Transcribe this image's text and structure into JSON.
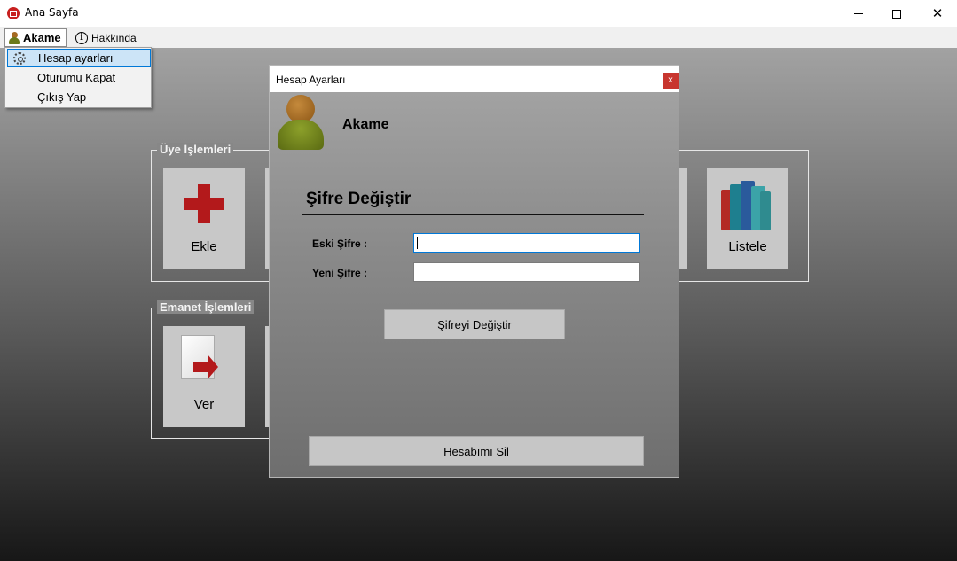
{
  "window": {
    "title": "Ana Sayfa"
  },
  "menubar": {
    "user_menu": "Akame",
    "about": "Hakkında"
  },
  "user_dropdown": [
    {
      "label": "Hesap ayarları",
      "icon": "gear-icon",
      "active": true
    },
    {
      "label": "Oturumu Kapat"
    },
    {
      "label": "Çıkış Yap"
    }
  ],
  "member_group": {
    "title": "Üye İşlemleri",
    "tiles": [
      {
        "label": "Ekle",
        "icon": "plus-icon"
      },
      {
        "label": "Listele",
        "icon": "books-icon"
      }
    ]
  },
  "loan_group": {
    "title": "Emanet İşlemleri",
    "tiles": [
      {
        "label": "Ver",
        "icon": "document-arrow-icon"
      }
    ]
  },
  "dialog": {
    "title": "Hesap Ayarları",
    "close_glyph": "x",
    "username": "Akame",
    "heading": "Şifre Değiştir",
    "old_password": {
      "label": "Eski Şifre :",
      "value": ""
    },
    "new_password": {
      "label": "Yeni Şifre :",
      "value": ""
    },
    "change_button": "Şifreyi Değiştir",
    "delete_button": "Hesabımı Sil"
  },
  "colors": {
    "accent": "#0078d7",
    "plus": "#b3191b",
    "dialog_close": "#c8362f"
  }
}
